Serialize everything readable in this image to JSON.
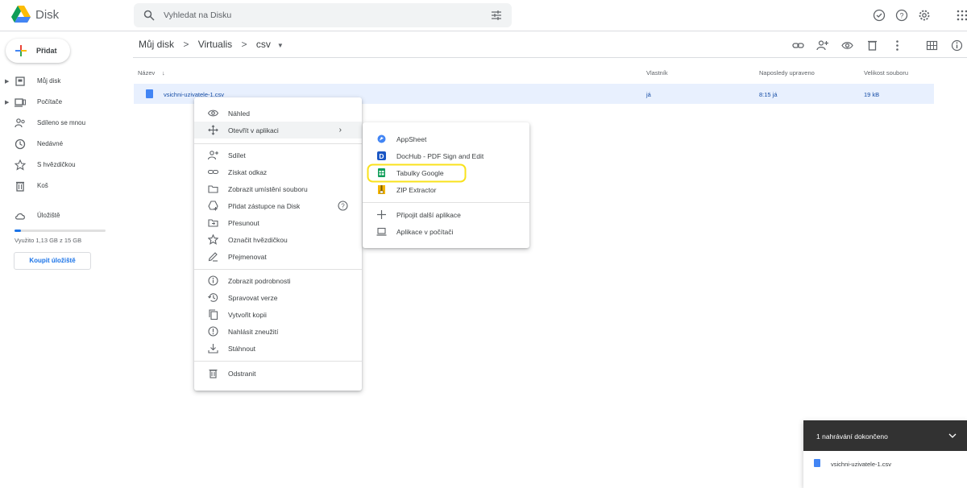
{
  "app": {
    "name": "Disk"
  },
  "search": {
    "placeholder": "Vyhledat na Disku"
  },
  "sidebar": {
    "new_label": "Přidat",
    "items": [
      {
        "label": "Můj disk",
        "icon": "drive-icon"
      },
      {
        "label": "Počítače",
        "icon": "computer-icon"
      },
      {
        "label": "Sdíleno se mnou",
        "icon": "shared-icon"
      },
      {
        "label": "Nedávné",
        "icon": "clock-icon"
      },
      {
        "label": "S hvězdičkou",
        "icon": "star-icon"
      },
      {
        "label": "Koš",
        "icon": "trash-icon"
      }
    ],
    "storage_label": "Úložiště",
    "storage_used": "Využito 1,13 GB z 15 GB",
    "storage_fraction": 0.075,
    "buy_label": "Koupit úložiště"
  },
  "breadcrumb": [
    "Můj disk",
    "Virtualis",
    "csv"
  ],
  "table": {
    "headers": {
      "name": "Název",
      "owner": "Vlastník",
      "modified": "Naposledy upraveno",
      "size": "Velikost souboru"
    },
    "rows": [
      {
        "name": "vsichni-uzivatele-1.csv",
        "owner": "já",
        "modified": "8:15 já",
        "size": "19 kB"
      }
    ]
  },
  "context_menu": {
    "groups": [
      [
        {
          "label": "Náhled",
          "icon": "eye-icon"
        },
        {
          "label": "Otevřít v aplikaci",
          "icon": "move-icon"
        }
      ],
      [
        {
          "label": "Sdílet",
          "icon": "add-person-icon"
        },
        {
          "label": "Získat odkaz",
          "icon": "link-icon"
        },
        {
          "label": "Zobrazit umístění souboru",
          "icon": "folder-icon"
        },
        {
          "label": "Přidat zástupce na Disk",
          "icon": "add-shortcut-icon"
        },
        {
          "label": "Přesunout",
          "icon": "move-folder-icon"
        },
        {
          "label": "Označit hvězdičkou",
          "icon": "star-icon"
        },
        {
          "label": "Přejmenovat",
          "icon": "pencil-icon"
        }
      ],
      [
        {
          "label": "Zobrazit podrobnosti",
          "icon": "info-icon"
        },
        {
          "label": "Spravovat verze",
          "icon": "history-icon"
        },
        {
          "label": "Vytvořit kopii",
          "icon": "copy-icon"
        },
        {
          "label": "Nahlásit zneužití",
          "icon": "report-icon"
        },
        {
          "label": "Stáhnout",
          "icon": "download-icon"
        }
      ],
      [
        {
          "label": "Odstranit",
          "icon": "trash-icon"
        }
      ]
    ]
  },
  "submenu": {
    "apps": [
      {
        "label": "AppSheet",
        "icon": "appsheet-icon"
      },
      {
        "label": "DocHub - PDF Sign and Edit",
        "icon": "dochub-icon"
      },
      {
        "label": "Tabulky Google",
        "icon": "sheets-icon"
      },
      {
        "label": "ZIP Extractor",
        "icon": "zip-icon"
      }
    ],
    "more": [
      {
        "label": "Připojit další aplikace",
        "icon": "plus-icon"
      },
      {
        "label": "Aplikace v počítači",
        "icon": "laptop-icon"
      }
    ]
  },
  "upload": {
    "title": "1 nahrávání dokončeno",
    "file": "vsichni-uzivatele-1.csv"
  },
  "colors": {
    "accent": "#1a73e8",
    "highlight": "#f9e21c",
    "sheets": "#0f9d58"
  }
}
